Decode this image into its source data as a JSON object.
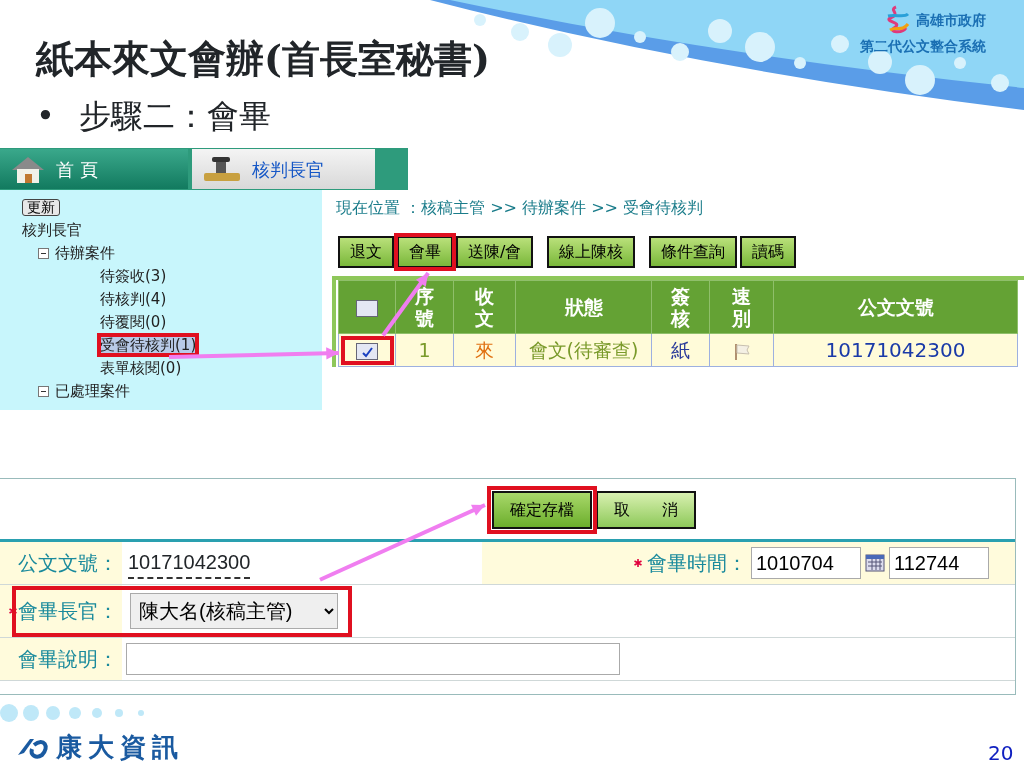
{
  "slide": {
    "title": "紙本來文會辦(首長室秘書)",
    "bullet_mark": "•",
    "bullet": "步驟二：會畢",
    "logo_name": "高雄市政府",
    "logo_subtitle": "第二代公文整合系統",
    "brand": "康大資訊",
    "page_number": "20"
  },
  "screen_top": {
    "tabs": [
      {
        "label": "首 頁",
        "selected": false
      },
      {
        "label": "核判長官",
        "selected": true
      }
    ],
    "refresh_button": "更新",
    "tree_root": "核判長官",
    "tree": [
      {
        "label": "待辦案件",
        "expanded": true,
        "children": [
          {
            "label": "待簽收(3)",
            "selected": false
          },
          {
            "label": "待核判(4)",
            "selected": false
          },
          {
            "label": "待覆閱(0)",
            "selected": false
          },
          {
            "label": "受會待核判(1)",
            "selected": true
          },
          {
            "label": "表單核閱(0)",
            "selected": false
          }
        ]
      },
      {
        "label": "已處理案件",
        "expanded": true
      }
    ],
    "breadcrumb": "現在位置 ：核稿主管 >> 待辦案件 >> 受會待核判",
    "toolbar_groups": [
      [
        "退文",
        "會畢",
        "送陳/會"
      ],
      [
        "線上陳核"
      ],
      [
        "條件查詢",
        "讀碼"
      ]
    ],
    "table": {
      "select_all_checked": false,
      "columns": [
        "序號",
        "收文",
        "狀態",
        "簽核",
        "速別",
        "公文文號"
      ],
      "rows": [
        {
          "checked": true,
          "seq": "1",
          "receive": "來",
          "status": "會文(待審查)",
          "sign": "紙",
          "doc_no": "10171042300"
        }
      ]
    }
  },
  "form": {
    "buttons": [
      {
        "label": "確定存檔",
        "kind": "primary"
      },
      {
        "label": "取　　消",
        "kind": "secondary"
      }
    ],
    "doc_no_label": "公文文號：",
    "doc_no": "10171042300",
    "time_label": "會畢時間：",
    "time_required": true,
    "date_value": "1010704",
    "time_value": "112744",
    "officer_label": "會畢長官：",
    "officer_required": true,
    "officer_value": "陳大名(核稿主管)",
    "note_label": "會畢說明：",
    "note_required": false
  }
}
